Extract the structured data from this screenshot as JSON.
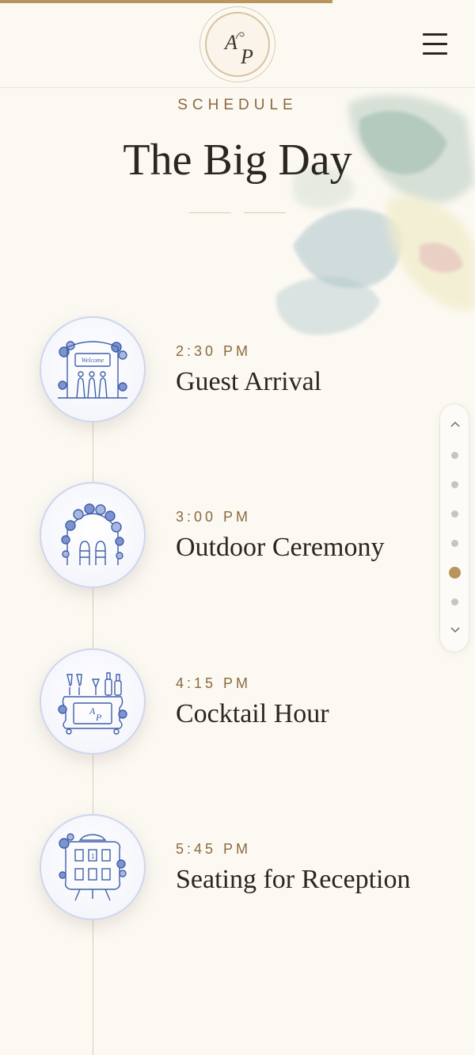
{
  "header": {
    "progress_fraction": 0.7,
    "monogram": {
      "letter_a": "A",
      "letter_p": "P"
    },
    "menu_icon": "hamburger-menu-icon"
  },
  "section": {
    "eyebrow": "SCHEDULE",
    "title": "The Big Day"
  },
  "events": [
    {
      "time": "2:30 PM",
      "title": "Guest Arrival",
      "icon": "welcome-sign-icon"
    },
    {
      "time": "3:00 PM",
      "title": "Outdoor Ceremony",
      "icon": "floral-arch-icon"
    },
    {
      "time": "4:15 PM",
      "title": "Cocktail Hour",
      "icon": "bar-cart-icon"
    },
    {
      "time": "5:45 PM",
      "title": "Seating for Reception",
      "icon": "seating-chart-icon"
    }
  ],
  "section_nav": {
    "dot_count": 6,
    "active_index": 4
  },
  "colors": {
    "background": "#fcf9f3",
    "accent_gold": "#b8955c",
    "text_dark": "#2b2620",
    "text_gold": "#8a6a3d",
    "icon_blue": "#3f5fa8"
  }
}
